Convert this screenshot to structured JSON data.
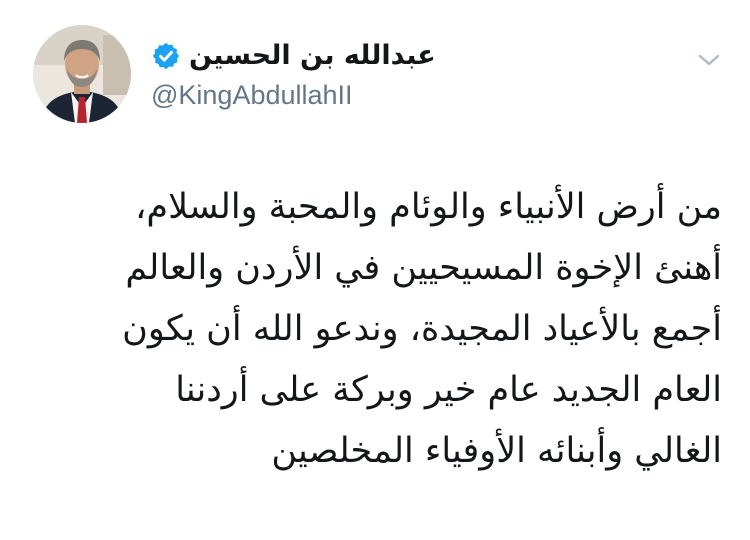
{
  "tweet": {
    "author": {
      "display_name": "عبدالله بن الحسين",
      "handle": "@KingAbdullahII",
      "verified": true,
      "verified_icon": "verified-badge-icon",
      "avatar_icon": "profile-photo"
    },
    "menu_icon": "chevron-down-icon",
    "text_lines": [
      "من أرض الأنبياء والوئام والمحبة والسلام،",
      "أهنئ الإخوة المسيحيين في الأردن والعالم",
      "أجمع بالأعياد المجيدة، وندعو الله أن يكون",
      "العام الجديد عام خير وبركة على أردننا",
      "الغالي وأبنائه الأوفياء المخلصين"
    ]
  },
  "colors": {
    "text_primary": "#14171a",
    "text_secondary": "#657786",
    "verified_blue": "#1da1f2",
    "chevron": "#aab8c2",
    "background": "#ffffff"
  }
}
